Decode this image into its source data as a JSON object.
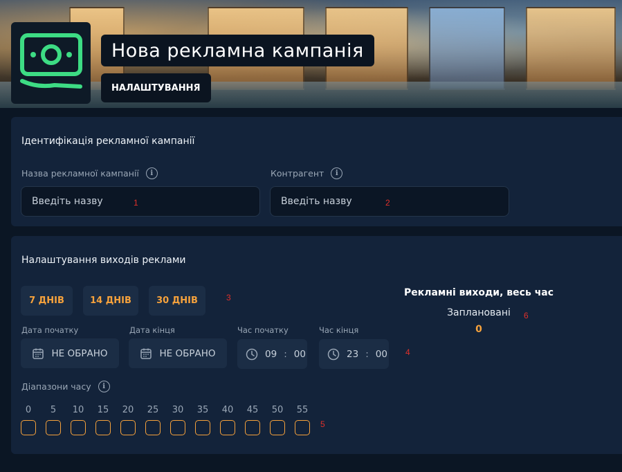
{
  "header": {
    "title": "Нова рекламна кампанія",
    "subtitle": "НАЛАШТУВАННЯ",
    "logo_icon": "money-bill-icon",
    "logo_color": "#3ddc84"
  },
  "identification": {
    "title": "Ідентифікація рекламної кампанії",
    "campaign_name": {
      "label": "Назва рекламної кампанії",
      "placeholder": "Введіть назву",
      "marker": "1"
    },
    "counterparty": {
      "label": "Контрагент",
      "placeholder": "Введіть назву",
      "marker": "2"
    }
  },
  "settings": {
    "title": "Налаштування виходів реклами",
    "day_presets": [
      "7 ДНІВ",
      "14 ДНІВ",
      "30 ДНІВ"
    ],
    "day_presets_marker": "3",
    "start_date": {
      "label": "Дата початку",
      "value": "НЕ ОБРАНО"
    },
    "end_date": {
      "label": "Дата кінця",
      "value": "НЕ ОБРАНО"
    },
    "start_time": {
      "label": "Час початку",
      "hours": "09",
      "minutes": "00"
    },
    "end_time": {
      "label": "Час кінця",
      "hours": "23",
      "minutes": "00"
    },
    "datetime_marker": "4",
    "ranges": {
      "label": "Діапазони часу",
      "minutes": [
        "0",
        "5",
        "10",
        "15",
        "20",
        "25",
        "30",
        "35",
        "40",
        "45",
        "50",
        "55"
      ],
      "marker": "5"
    },
    "stats": {
      "title": "Рекламні виходи, весь час",
      "label": "Заплановані",
      "value": "0",
      "marker": "6"
    }
  },
  "colors": {
    "accent": "#f6a23c",
    "marker": "#e0302a",
    "panel": "#13233a"
  }
}
